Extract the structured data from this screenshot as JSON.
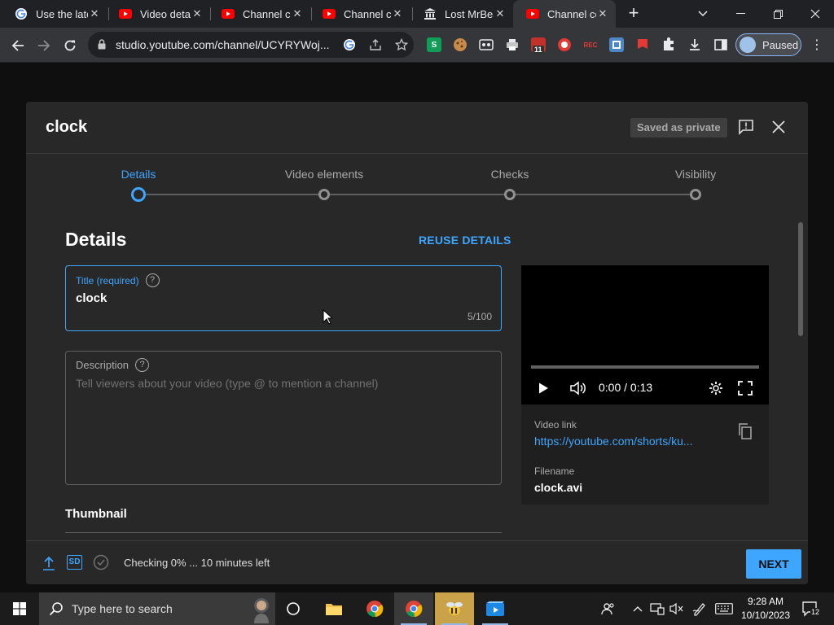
{
  "browser": {
    "tabs": [
      {
        "title": "Use the latest",
        "favicon": "google-g-icon",
        "active": false
      },
      {
        "title": "Video details",
        "favicon": "youtube-icon",
        "active": false
      },
      {
        "title": "Channel cu",
        "favicon": "youtube-icon",
        "active": false
      },
      {
        "title": "Channel cu",
        "favicon": "youtube-icon",
        "active": false
      },
      {
        "title": "Lost MrBea",
        "favicon": "museum-icon",
        "active": false
      },
      {
        "title": "Channel co",
        "favicon": "youtube-icon",
        "active": true
      }
    ],
    "url": "studio.youtube.com/channel/UCYRYWoj...",
    "profile_label": "Paused",
    "extension_badge": "11",
    "ext_s_label": "S",
    "ext_rec_label": "REC"
  },
  "dialog": {
    "title": "clock",
    "saved_badge": "Saved as private",
    "steps": [
      {
        "label": "Details",
        "active": true
      },
      {
        "label": "Video elements",
        "active": false
      },
      {
        "label": "Checks",
        "active": false
      },
      {
        "label": "Visibility",
        "active": false
      }
    ],
    "section_title": "Details",
    "reuse_label": "REUSE DETAILS",
    "title_field": {
      "label": "Title (required)",
      "value": "clock",
      "counter": "5/100"
    },
    "description_field": {
      "label": "Description",
      "placeholder": "Tell viewers about your video (type @ to mention a channel)"
    },
    "thumbnail_title": "Thumbnail",
    "help_glyph": "?",
    "preview": {
      "time": "0:00 / 0:13",
      "progress": 0,
      "video_link_label": "Video link",
      "video_link": "https://youtube.com/shorts/ku...",
      "filename_label": "Filename",
      "filename": "clock.avi"
    },
    "footer": {
      "sd_label": "SD",
      "status": "Checking 0% ... 10 minutes left",
      "next_label": "NEXT"
    }
  },
  "taskbar": {
    "search_placeholder": "Type here to search",
    "time": "9:28 AM",
    "date": "10/10/2023",
    "notification_count": "12"
  },
  "colors": {
    "accent": "#3ea6ff",
    "dialog_bg": "#282828",
    "page_bg": "#0f0f0f"
  }
}
